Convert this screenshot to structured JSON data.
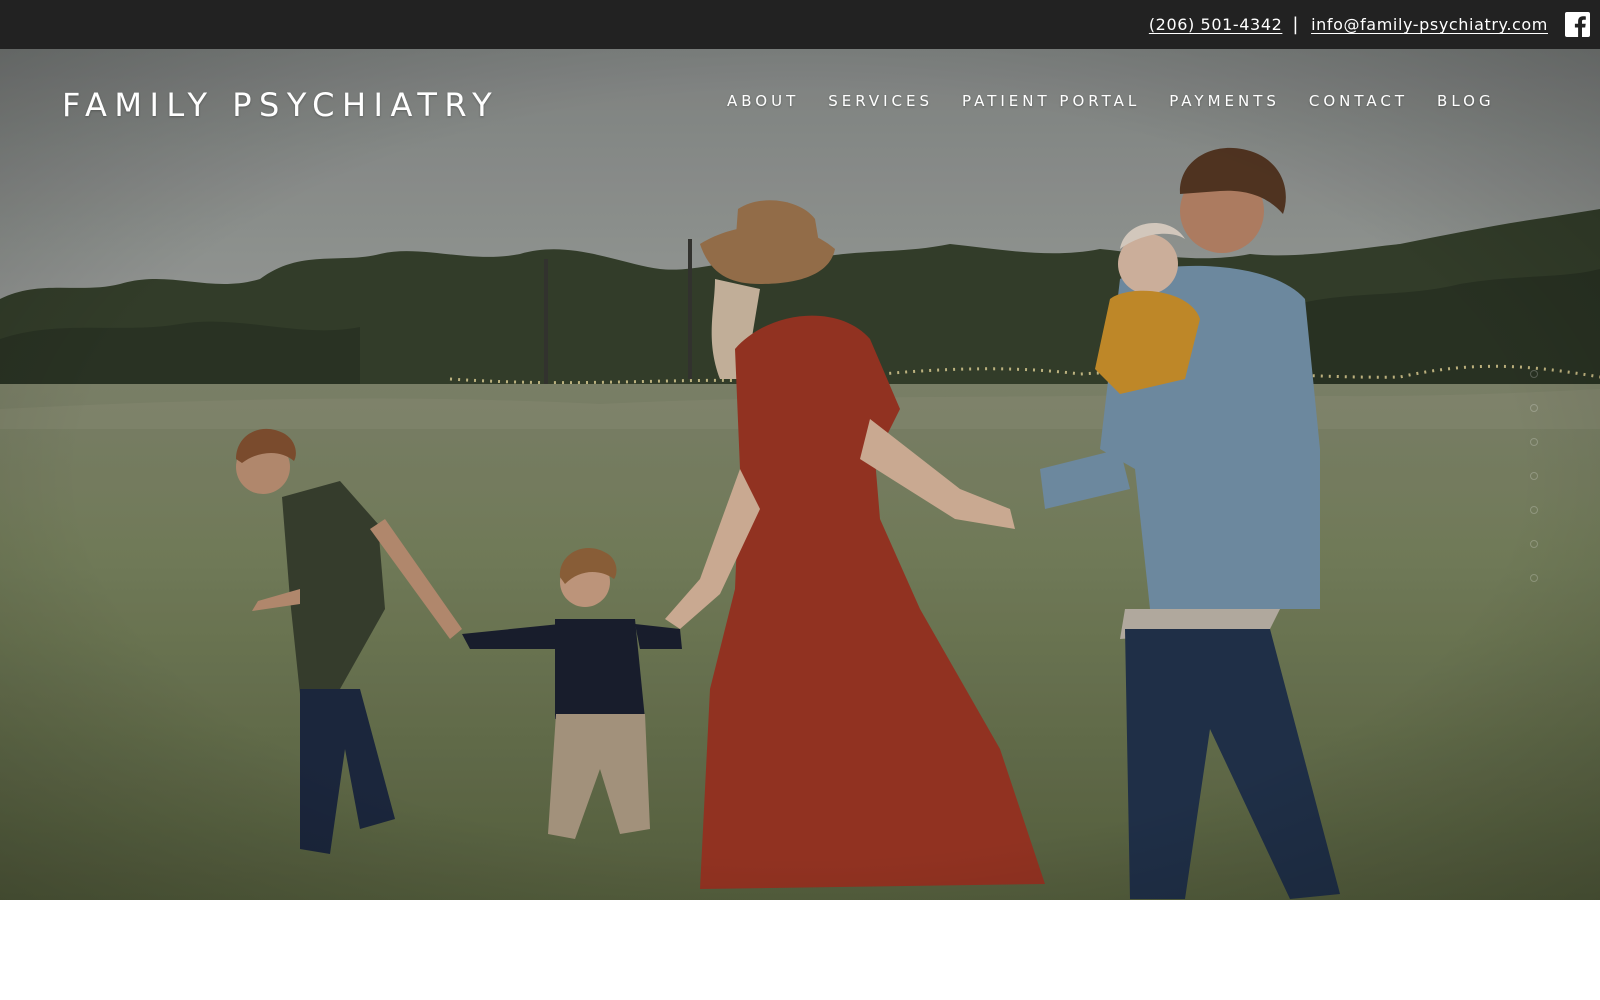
{
  "topbar": {
    "phone": "(206) 501-4342",
    "separator": "|",
    "email": "info@family-psychiatry.com",
    "social_icon": "facebook-icon"
  },
  "header": {
    "site_title": "FAMILY PSYCHIATRY"
  },
  "nav": {
    "items": [
      {
        "label": "ABOUT"
      },
      {
        "label": "SERVICES"
      },
      {
        "label": "PATIENT PORTAL"
      },
      {
        "label": "PAYMENTS"
      },
      {
        "label": "CONTACT"
      },
      {
        "label": "BLOG"
      }
    ]
  },
  "hero": {
    "image_description": "family-walking-in-field-photo"
  },
  "colors": {
    "topbar_bg": "#222222",
    "text_on_dark": "#ffffff",
    "page_bg": "#ffffff"
  }
}
